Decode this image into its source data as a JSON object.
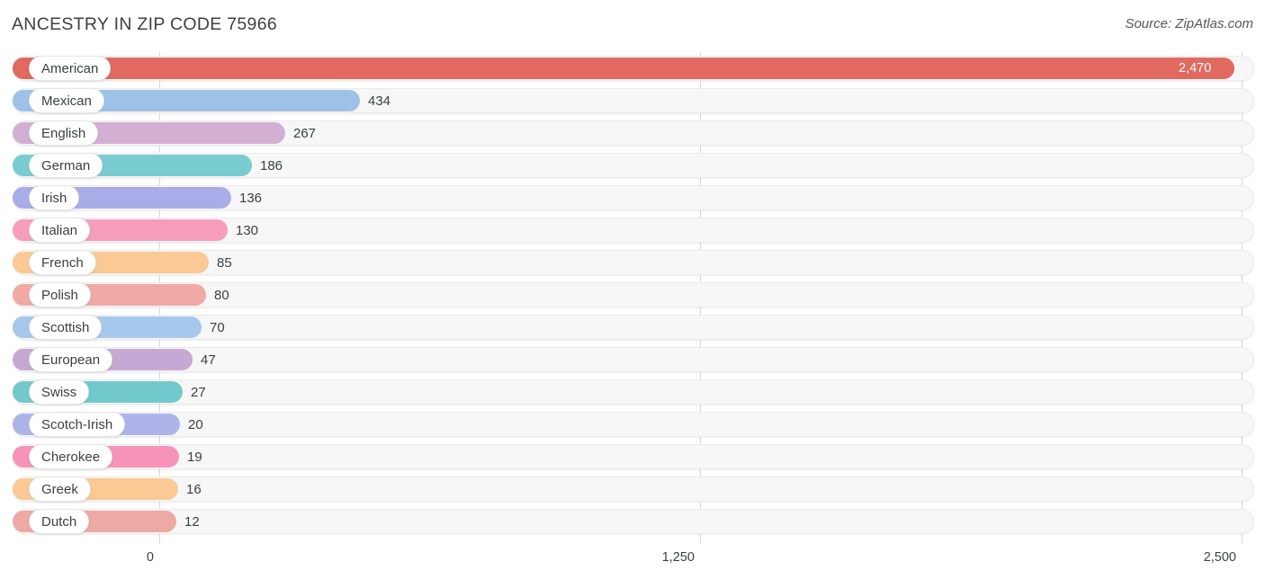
{
  "header": {
    "title": "ANCESTRY IN ZIP CODE 75966",
    "source": "Source: ZipAtlas.com"
  },
  "axis": {
    "ticks": [
      {
        "label": "0",
        "value": 0,
        "x": 177
      },
      {
        "label": "1,250",
        "value": 1250,
        "x": 778
      },
      {
        "label": "2,500",
        "value": 2500,
        "x": 1380
      }
    ]
  },
  "chart_data": {
    "type": "bar",
    "orientation": "horizontal",
    "title": "ANCESTRY IN ZIP CODE 75966",
    "xlabel": "",
    "ylabel": "",
    "xlim": [
      0,
      2500
    ],
    "grid": true,
    "legend": false,
    "categories": [
      "American",
      "Mexican",
      "English",
      "German",
      "Irish",
      "Italian",
      "French",
      "Polish",
      "Scottish",
      "European",
      "Swiss",
      "Scotch-Irish",
      "Cherokee",
      "Greek",
      "Dutch"
    ],
    "values": [
      2470,
      434,
      267,
      186,
      136,
      130,
      85,
      80,
      70,
      47,
      27,
      20,
      19,
      16,
      12
    ],
    "value_labels": [
      "2,470",
      "434",
      "267",
      "186",
      "136",
      "130",
      "85",
      "80",
      "70",
      "47",
      "27",
      "20",
      "19",
      "16",
      "12"
    ],
    "colors": [
      "#e2695f",
      "#9ec2e7",
      "#d3afd3",
      "#79ccd0",
      "#a8ade8",
      "#f79dbc",
      "#fbc994",
      "#f0a9a5",
      "#a6c8ec",
      "#c7a8d4",
      "#72c9cc",
      "#aeb4ea",
      "#f793b8",
      "#fbc994",
      "#eda9a3"
    ]
  },
  "bars": [
    {
      "label": "American",
      "value": 2470,
      "value_label": "2,470",
      "color": "#e2695f",
      "bar_end": 1372,
      "label_inside": true
    },
    {
      "label": "Mexican",
      "value": 434,
      "value_label": "434",
      "color": "#9ec2e7",
      "bar_end": 400,
      "label_inside": false
    },
    {
      "label": "English",
      "value": 267,
      "value_label": "267",
      "color": "#d3afd3",
      "bar_end": 317,
      "label_inside": false
    },
    {
      "label": "German",
      "value": 186,
      "value_label": "186",
      "color": "#79ccd0",
      "bar_end": 280,
      "label_inside": false
    },
    {
      "label": "Irish",
      "value": 136,
      "value_label": "136",
      "color": "#a8ade8",
      "bar_end": 257,
      "label_inside": false
    },
    {
      "label": "Italian",
      "value": 130,
      "value_label": "130",
      "color": "#f79dbc",
      "bar_end": 253,
      "label_inside": false
    },
    {
      "label": "French",
      "value": 85,
      "value_label": "85",
      "color": "#fbc994",
      "bar_end": 232,
      "label_inside": false
    },
    {
      "label": "Polish",
      "value": 80,
      "value_label": "80",
      "color": "#f0a9a5",
      "bar_end": 229,
      "label_inside": false
    },
    {
      "label": "Scottish",
      "value": 70,
      "value_label": "70",
      "color": "#a6c8ec",
      "bar_end": 224,
      "label_inside": false
    },
    {
      "label": "European",
      "value": 47,
      "value_label": "47",
      "color": "#c7a8d4",
      "bar_end": 214,
      "label_inside": false
    },
    {
      "label": "Swiss",
      "value": 27,
      "value_label": "27",
      "color": "#72c9cc",
      "bar_end": 203,
      "label_inside": false
    },
    {
      "label": "Scotch-Irish",
      "value": 20,
      "value_label": "20",
      "color": "#aeb4ea",
      "bar_end": 200,
      "label_inside": false
    },
    {
      "label": "Cherokee",
      "value": 19,
      "value_label": "19",
      "color": "#f793b8",
      "bar_end": 199,
      "label_inside": false
    },
    {
      "label": "Greek",
      "value": 16,
      "value_label": "16",
      "color": "#fbc994",
      "bar_end": 198,
      "label_inside": false
    },
    {
      "label": "Dutch",
      "value": 12,
      "value_label": "12",
      "color": "#eda9a3",
      "bar_end": 196,
      "label_inside": false
    }
  ]
}
